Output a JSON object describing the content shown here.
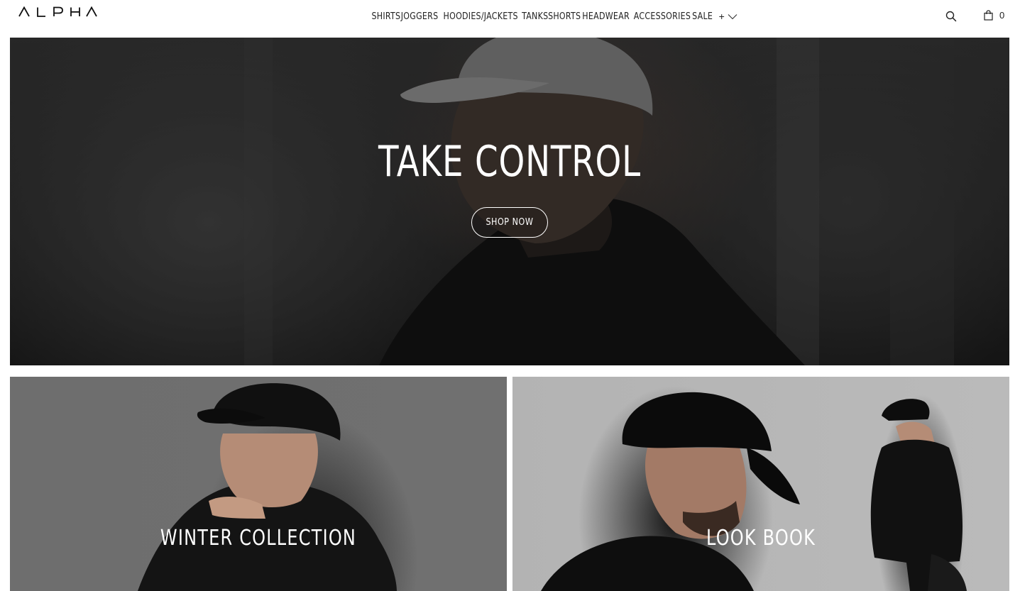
{
  "header": {
    "logo_text": "ALPHA",
    "nav": [
      {
        "label": "SHIRTS"
      },
      {
        "label": "JOGGERS"
      },
      {
        "label": "HOODIES/JACKETS"
      },
      {
        "label": "TANKS"
      },
      {
        "label": "SHORTS"
      },
      {
        "label": "HEADWEAR"
      },
      {
        "label": "ACCESSORIES"
      },
      {
        "label": "SALE"
      }
    ],
    "more_label": "+",
    "cart_count": "0"
  },
  "hero": {
    "title": "TAKE CONTROL",
    "button_label": "SHOP NOW"
  },
  "tiles": [
    {
      "label": "WINTER COLLECTION"
    },
    {
      "label": "LOOK BOOK"
    }
  ]
}
